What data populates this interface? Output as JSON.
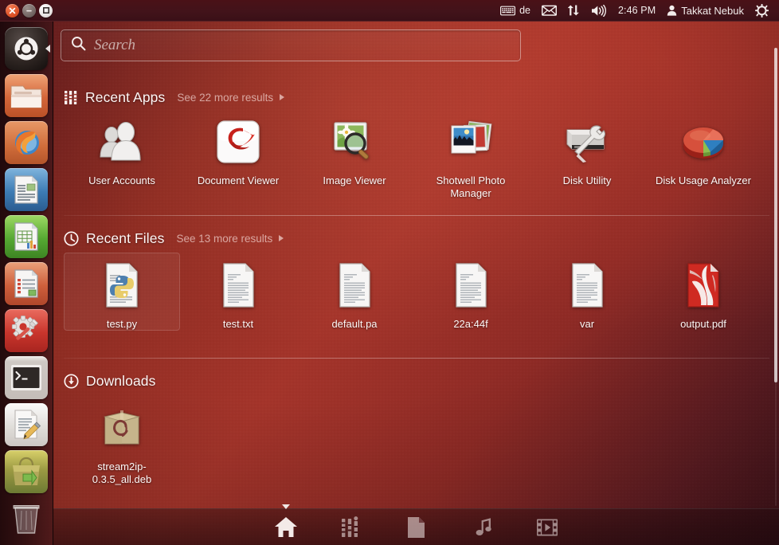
{
  "window_controls": [
    {
      "name": "close",
      "label": "Close",
      "icon": "close-icon",
      "color": "#d84b20"
    },
    {
      "name": "minimize",
      "label": "Minimize",
      "icon": "minimize-icon",
      "color": "#6e615f"
    },
    {
      "name": "maximize",
      "label": "Restore",
      "icon": "maximize-icon",
      "color": "#e2dedd"
    }
  ],
  "panel": {
    "keyboard_layout": "de",
    "keyboard_icon": "keyboard-icon",
    "messaging_icon": "envelope-icon",
    "network_icon": "network-updown-icon",
    "volume_icon": "speaker-icon",
    "clock": "2:46 PM",
    "user_icon": "user-icon",
    "user_name": "Takkat Nebuk",
    "session_icon": "session-power-gear-icon"
  },
  "launcher": {
    "items": [
      {
        "label": "Ubuntu Dash Home",
        "icon": "ubuntu-logo-icon",
        "tile": "bfb",
        "running": false,
        "arrow": true
      },
      {
        "label": "Files",
        "icon": "folder-icon",
        "tile": "folder",
        "running": false,
        "arrow": false
      },
      {
        "label": "Firefox Web Browser",
        "icon": "firefox-icon",
        "tile": "firefox",
        "running": false,
        "arrow": false
      },
      {
        "label": "LibreOffice Writer",
        "icon": "libreoffice-writer-icon",
        "tile": "writer",
        "running": false,
        "arrow": false
      },
      {
        "label": "LibreOffice Calc",
        "icon": "libreoffice-calc-icon",
        "tile": "calc",
        "running": false,
        "arrow": false
      },
      {
        "label": "LibreOffice Impress",
        "icon": "libreoffice-impress-icon",
        "tile": "impress",
        "running": false,
        "arrow": false
      },
      {
        "label": "System Settings",
        "icon": "gear-wrench-icon",
        "tile": "settings",
        "running": false,
        "arrow": false
      },
      {
        "label": "Terminal",
        "icon": "terminal-icon",
        "tile": "terminal",
        "running": false,
        "arrow": false
      },
      {
        "label": "Text Editor",
        "icon": "document-pencil-icon",
        "tile": "gedit",
        "running": false,
        "arrow": false
      },
      {
        "label": "Ubuntu Software Center",
        "icon": "software-bag-icon",
        "tile": "software",
        "running": false,
        "arrow": false
      },
      {
        "label": "Trash",
        "icon": "trash-icon",
        "tile": "trash",
        "running": false,
        "arrow": false
      }
    ]
  },
  "search": {
    "value": "",
    "placeholder": "Search",
    "icon": "search-icon"
  },
  "categories": [
    {
      "id": "recent-apps",
      "title": "Recent Apps",
      "icon": "applications-lens-icon",
      "more_label": "See 22 more results",
      "more_count": 22,
      "results": [
        {
          "label": "User Accounts",
          "icon": "user-accounts-icon",
          "selected": false
        },
        {
          "label": "Document Viewer",
          "icon": "evince-document-viewer-icon",
          "selected": false
        },
        {
          "label": "Image Viewer",
          "icon": "eog-image-viewer-icon",
          "selected": false
        },
        {
          "label": "Shotwell Photo Manager",
          "icon": "shotwell-icon",
          "selected": false
        },
        {
          "label": "Disk Utility",
          "icon": "disk-utility-icon",
          "selected": false
        },
        {
          "label": "Disk Usage Analyzer",
          "icon": "disk-usage-analyzer-icon",
          "selected": false
        }
      ]
    },
    {
      "id": "recent-files",
      "title": "Recent Files",
      "icon": "clock-icon",
      "more_label": "See 13 more results",
      "more_count": 13,
      "results": [
        {
          "label": "test.py",
          "icon": "python-file-icon",
          "selected": true
        },
        {
          "label": "test.txt",
          "icon": "text-file-icon",
          "selected": false
        },
        {
          "label": "default.pa",
          "icon": "text-file-icon",
          "selected": false
        },
        {
          "label": "22a:44f",
          "icon": "text-file-icon",
          "selected": false
        },
        {
          "label": "var",
          "icon": "text-file-icon",
          "selected": false
        },
        {
          "label": "output.pdf",
          "icon": "pdf-file-icon",
          "selected": false
        }
      ]
    },
    {
      "id": "downloads",
      "title": "Downloads",
      "icon": "download-arrow-icon",
      "more_label": "",
      "results": [
        {
          "label": "stream2ip-0.3.5_all.deb",
          "icon": "deb-package-icon",
          "selected": false
        }
      ]
    }
  ],
  "lens_bar": {
    "lenses": [
      {
        "id": "home",
        "label": "Home",
        "icon": "home-icon",
        "active": true
      },
      {
        "id": "applications",
        "label": "Applications",
        "icon": "applications-lens-icon",
        "active": false
      },
      {
        "id": "files",
        "label": "Files & Folders",
        "icon": "files-lens-icon",
        "active": false
      },
      {
        "id": "music",
        "label": "Music",
        "icon": "music-note-icon",
        "active": false
      },
      {
        "id": "video",
        "label": "Videos",
        "icon": "film-strip-icon",
        "active": false
      }
    ]
  },
  "scrollbar": {
    "position_percent": 0,
    "visible": true
  },
  "theme": {
    "dash_accent": "#a4342a",
    "panel_bg": "#42131a",
    "text_color": "#fdf6f5",
    "dim_text_color": "#cfb8b5"
  }
}
